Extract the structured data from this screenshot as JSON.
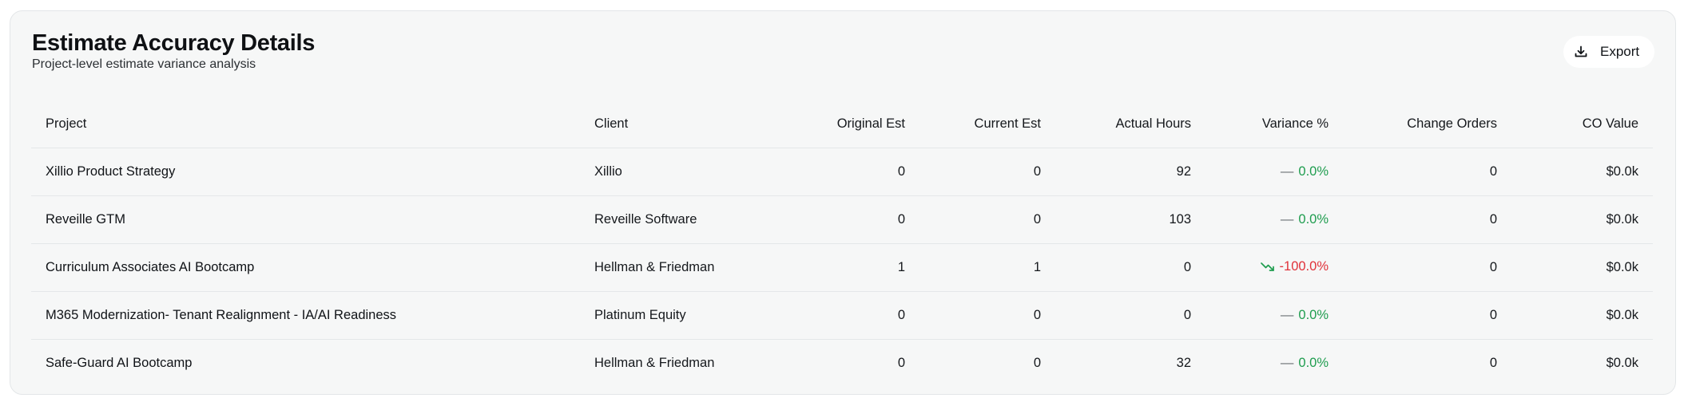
{
  "header": {
    "title": "Estimate Accuracy Details",
    "subtitle": "Project-level estimate variance analysis",
    "export_label": "Export",
    "export_icon": "download-icon"
  },
  "colors": {
    "positive": "#1f9d4f",
    "negative": "#e0323a",
    "card_bg": "#f6f7f7"
  },
  "table": {
    "columns": [
      "Project",
      "Client",
      "Original Est",
      "Current Est",
      "Actual Hours",
      "Variance %",
      "Change Orders",
      "CO Value"
    ],
    "rows": [
      {
        "project": "Xillio Product Strategy",
        "client": "Xillio",
        "original_est": "0",
        "current_est": "0",
        "actual_hours": "92",
        "variance_icon": "—",
        "variance": "0.0%",
        "trend": "flat",
        "change_orders": "0",
        "co_value": "$0.0k"
      },
      {
        "project": "Reveille GTM",
        "client": "Reveille Software",
        "original_est": "0",
        "current_est": "0",
        "actual_hours": "103",
        "variance_icon": "—",
        "variance": "0.0%",
        "trend": "flat",
        "change_orders": "0",
        "co_value": "$0.0k"
      },
      {
        "project": "Curriculum Associates AI Bootcamp",
        "client": "Hellman & Friedman",
        "original_est": "1",
        "current_est": "1",
        "actual_hours": "0",
        "variance_icon": "",
        "variance": "-100.0%",
        "trend": "down",
        "change_orders": "0",
        "co_value": "$0.0k"
      },
      {
        "project": "M365 Modernization- Tenant Realignment - IA/AI Readiness",
        "client": "Platinum Equity",
        "original_est": "0",
        "current_est": "0",
        "actual_hours": "0",
        "variance_icon": "—",
        "variance": "0.0%",
        "trend": "flat",
        "change_orders": "0",
        "co_value": "$0.0k"
      },
      {
        "project": "Safe-Guard AI Bootcamp",
        "client": "Hellman & Friedman",
        "original_est": "0",
        "current_est": "0",
        "actual_hours": "32",
        "variance_icon": "—",
        "variance": "0.0%",
        "trend": "flat",
        "change_orders": "0",
        "co_value": "$0.0k"
      }
    ]
  }
}
